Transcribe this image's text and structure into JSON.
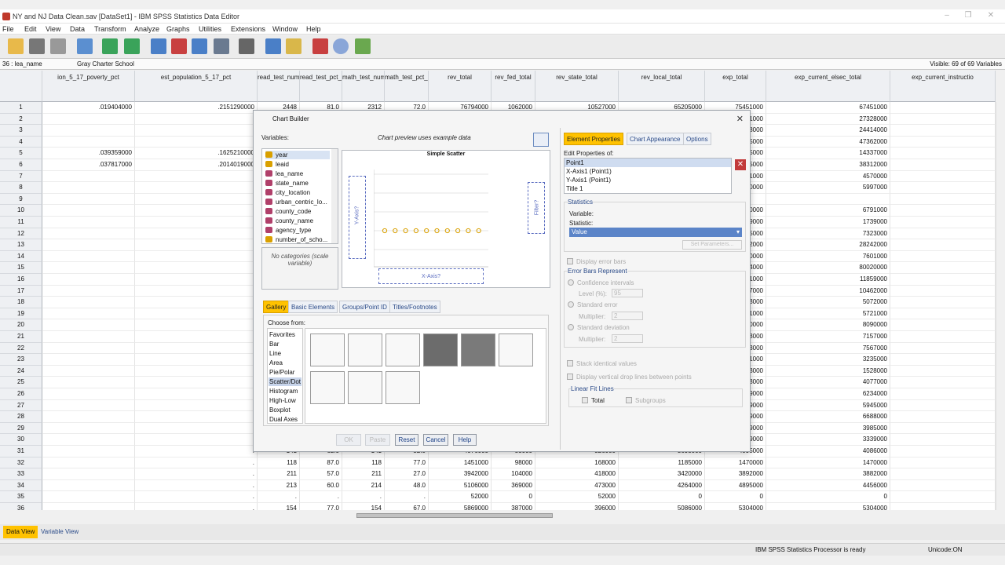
{
  "window": {
    "title": "NY and NJ Data Clean.sav [DataSet1] - IBM SPSS Statistics Data Editor"
  },
  "menu": [
    "File",
    "Edit",
    "View",
    "Data",
    "Transform",
    "Analyze",
    "Graphs",
    "Utilities",
    "Extensions",
    "Window",
    "Help"
  ],
  "cellbar": {
    "ref": "36 : lea_name",
    "value": "Gray Charter School",
    "visible": "Visible: 69 of 69 Variables"
  },
  "columns": [
    "ion_5_17_poverty_pct",
    "est_population_5_17_pct",
    "read_test_num_valid",
    "read_test_pct_prof_midpt",
    "math_test_num_valid",
    "math_test_pct_prof_midpt",
    "rev_total",
    "rev_fed_total",
    "rev_state_total",
    "rev_local_total",
    "exp_total",
    "exp_current_elsec_total",
    "exp_current_instructio"
  ],
  "rows": [
    {
      "n": "1",
      "c": [
        ".019404000",
        ".2151290000",
        "2448",
        "81.0",
        "2312",
        "72.0",
        "76794000",
        "1062000",
        "10527000",
        "65205000",
        "75451000",
        "67451000",
        ""
      ]
    },
    {
      "n": "2",
      "c": [
        "",
        ".",
        "",
        "",
        "",
        "",
        "",
        "",
        "",
        "",
        "1000",
        "27328000",
        ""
      ]
    },
    {
      "n": "3",
      "c": [
        "",
        ".",
        "",
        "",
        "",
        "",
        "",
        "",
        "",
        "",
        "8000",
        "24414000",
        ""
      ]
    },
    {
      "n": "4",
      "c": [
        "",
        ".",
        "",
        "",
        "",
        "",
        "",
        "",
        "",
        "",
        "5000",
        "47362000",
        ""
      ]
    },
    {
      "n": "5",
      "c": [
        ".039359000",
        ".1625210000",
        "",
        "",
        "",
        "",
        "",
        "",
        "",
        "",
        "5000",
        "14337000",
        ""
      ]
    },
    {
      "n": "6",
      "c": [
        ".037817000",
        ".2014019000",
        "",
        "",
        "",
        "",
        "",
        "",
        "",
        "",
        "5000",
        "38312000",
        ""
      ]
    },
    {
      "n": "7",
      "c": [
        "",
        ".",
        "",
        "",
        "",
        "",
        "",
        "",
        "",
        "",
        "1000",
        "4570000",
        ""
      ]
    },
    {
      "n": "8",
      "c": [
        "",
        ".",
        "",
        "",
        "",
        "",
        "",
        "",
        "",
        "",
        "0000",
        "5997000",
        ""
      ]
    },
    {
      "n": "9",
      "c": [
        "",
        ".",
        "",
        "",
        "",
        "",
        "",
        "",
        "",
        "",
        "",
        "",
        ""
      ]
    },
    {
      "n": "10",
      "c": [
        "",
        ".",
        "",
        "",
        "",
        "",
        "",
        "",
        "",
        "",
        "0000",
        "6791000",
        ""
      ]
    },
    {
      "n": "11",
      "c": [
        "",
        ".",
        "",
        "",
        "",
        "",
        "",
        "",
        "",
        "",
        "9000",
        "1739000",
        ""
      ]
    },
    {
      "n": "12",
      "c": [
        "",
        ".",
        "",
        "",
        "",
        "",
        "",
        "",
        "",
        "",
        "5000",
        "7323000",
        ""
      ]
    },
    {
      "n": "13",
      "c": [
        "",
        ".",
        "",
        "",
        "",
        "",
        "",
        "",
        "",
        "",
        "2000",
        "28242000",
        ""
      ]
    },
    {
      "n": "14",
      "c": [
        "",
        ".",
        "",
        "",
        "",
        "",
        "",
        "",
        "",
        "",
        "0000",
        "7601000",
        ""
      ]
    },
    {
      "n": "15",
      "c": [
        "",
        ".",
        "",
        "",
        "",
        "",
        "",
        "",
        "",
        "",
        "4000",
        "80020000",
        ""
      ]
    },
    {
      "n": "16",
      "c": [
        "",
        ".",
        "",
        "",
        "",
        "",
        "",
        "",
        "",
        "",
        "1000",
        "11859000",
        ""
      ]
    },
    {
      "n": "17",
      "c": [
        "",
        ".",
        "",
        "",
        "",
        "",
        "",
        "",
        "",
        "",
        "7000",
        "10462000",
        ""
      ]
    },
    {
      "n": "18",
      "c": [
        "",
        ".",
        "",
        "",
        "",
        "",
        "",
        "",
        "",
        "",
        "3000",
        "5072000",
        ""
      ]
    },
    {
      "n": "19",
      "c": [
        "",
        ".",
        "",
        "",
        "",
        "",
        "",
        "",
        "",
        "",
        "1000",
        "5721000",
        ""
      ]
    },
    {
      "n": "20",
      "c": [
        "",
        ".",
        "",
        "",
        "",
        "",
        "",
        "",
        "",
        "",
        "0000",
        "8090000",
        ""
      ]
    },
    {
      "n": "21",
      "c": [
        "",
        ".",
        "",
        "",
        "",
        "",
        "",
        "",
        "",
        "",
        "3000",
        "7157000",
        ""
      ]
    },
    {
      "n": "22",
      "c": [
        "",
        ".",
        "",
        "",
        "",
        "",
        "",
        "",
        "",
        "",
        "3000",
        "7567000",
        ""
      ]
    },
    {
      "n": "23",
      "c": [
        "",
        ".",
        "",
        "",
        "",
        "",
        "",
        "",
        "",
        "",
        "1000",
        "3235000",
        ""
      ]
    },
    {
      "n": "24",
      "c": [
        "",
        ".",
        "",
        "",
        "",
        "",
        "",
        "",
        "",
        "",
        "3000",
        "1528000",
        ""
      ]
    },
    {
      "n": "25",
      "c": [
        "",
        ".",
        "",
        "",
        "",
        "",
        "",
        "",
        "",
        "",
        "3000",
        "4077000",
        ""
      ]
    },
    {
      "n": "26",
      "c": [
        "",
        ".",
        "",
        "",
        "",
        "",
        "",
        "",
        "",
        "",
        "9000",
        "6234000",
        ""
      ]
    },
    {
      "n": "27",
      "c": [
        "",
        ".",
        "",
        "",
        "",
        "",
        "",
        "",
        "",
        "",
        "9000",
        "5945000",
        ""
      ]
    },
    {
      "n": "28",
      "c": [
        "",
        ".",
        "",
        "",
        "",
        "",
        "",
        "",
        "",
        "",
        "9000",
        "6688000",
        ""
      ]
    },
    {
      "n": "29",
      "c": [
        "",
        ".",
        "",
        "",
        "",
        "",
        "",
        "",
        "",
        "",
        "9000",
        "3985000",
        ""
      ]
    },
    {
      "n": "30",
      "c": [
        "",
        ".",
        "",
        "",
        "",
        "",
        "",
        "",
        "",
        "",
        "9000",
        "3339000",
        ""
      ]
    },
    {
      "n": "31",
      "c": [
        "",
        ".",
        "141",
        "62.0",
        "141",
        "52.0",
        "4076000",
        "55000",
        "326000",
        "3695000",
        "4095000",
        "4086000",
        ""
      ]
    },
    {
      "n": "32",
      "c": [
        "",
        ".",
        "118",
        "87.0",
        "118",
        "77.0",
        "1451000",
        "98000",
        "168000",
        "1185000",
        "1470000",
        "1470000",
        ""
      ]
    },
    {
      "n": "33",
      "c": [
        "",
        ".",
        "211",
        "57.0",
        "211",
        "27.0",
        "3942000",
        "104000",
        "418000",
        "3420000",
        "3892000",
        "3882000",
        ""
      ]
    },
    {
      "n": "34",
      "c": [
        "",
        ".",
        "213",
        "60.0",
        "214",
        "48.0",
        "5106000",
        "369000",
        "473000",
        "4264000",
        "4895000",
        "4456000",
        ""
      ]
    },
    {
      "n": "35",
      "c": [
        "",
        ".",
        ".",
        ".",
        ".",
        ".",
        "52000",
        "0",
        "52000",
        "0",
        "0",
        "0",
        ""
      ]
    },
    {
      "n": "36",
      "c": [
        "",
        ".",
        "154",
        "77.0",
        "154",
        "67.0",
        "5869000",
        "387000",
        "396000",
        "5086000",
        "5304000",
        "5304000",
        ""
      ]
    }
  ],
  "tabs": {
    "data_view": "Data View",
    "variable_view": "Variable View"
  },
  "status": {
    "processor": "IBM SPSS Statistics Processor is ready",
    "unicode": "Unicode:ON"
  },
  "dialog": {
    "title": "Chart Builder",
    "variables_label": "Variables:",
    "preview_note": "Chart preview uses example data",
    "variables": [
      {
        "name": "year",
        "type": "scale"
      },
      {
        "name": "leaid",
        "type": "scale"
      },
      {
        "name": "lea_name",
        "type": "nominal"
      },
      {
        "name": "state_name",
        "type": "nominal"
      },
      {
        "name": "city_location",
        "type": "nominal"
      },
      {
        "name": "urban_centric_lo...",
        "type": "nominal"
      },
      {
        "name": "county_code",
        "type": "nominal"
      },
      {
        "name": "county_name",
        "type": "nominal"
      },
      {
        "name": "agency_type",
        "type": "nominal"
      },
      {
        "name": "number_of_scho...",
        "type": "scale"
      }
    ],
    "no_categories": "No categories (scale variable)",
    "preview": {
      "title": "Simple Scatter",
      "y_axis": "Y-Axis?",
      "x_axis": "X-Axis?",
      "filter": "Filter?"
    },
    "gallery_tabs": [
      "Gallery",
      "Basic Elements",
      "Groups/Point ID",
      "Titles/Footnotes"
    ],
    "choose_from_label": "Choose from:",
    "chart_types": [
      "Favorites",
      "Bar",
      "Line",
      "Area",
      "Pie/Polar",
      "Scatter/Dot",
      "Histogram",
      "High-Low",
      "Boxplot",
      "Dual Axes"
    ],
    "selected_type": "Scatter/Dot",
    "buttons": {
      "ok": "OK",
      "paste": "Paste",
      "reset": "Reset",
      "cancel": "Cancel",
      "help": "Help"
    },
    "right_tabs": [
      "Element Properties",
      "Chart Appearance",
      "Options"
    ],
    "edit_props_label": "Edit Properties of:",
    "edit_props_items": [
      "Point1",
      "X-Axis1 (Point1)",
      "Y-Axis1 (Point1)",
      "Title 1"
    ],
    "statistics": {
      "group": "Statistics",
      "variable_label": "Variable:",
      "statistic_label": "Statistic:",
      "value": "Value",
      "set_parameters": "Set Parameters..."
    },
    "display_error_bars": "Display error bars",
    "error_bars": {
      "group": "Error Bars Represent",
      "ci": "Confidence intervals",
      "level_label": "Level (%):",
      "level": "95",
      "se": "Standard error",
      "se_mult_label": "Multiplier:",
      "se_mult": "2",
      "sd": "Standard deviation",
      "sd_mult_label": "Multiplier:",
      "sd_mult": "2"
    },
    "stack_identical": "Stack identical values",
    "drop_lines": "Display vertical drop lines between points",
    "linear_fit": {
      "group": "Linear Fit Lines",
      "total": "Total",
      "subgroups": "Subgroups"
    }
  }
}
